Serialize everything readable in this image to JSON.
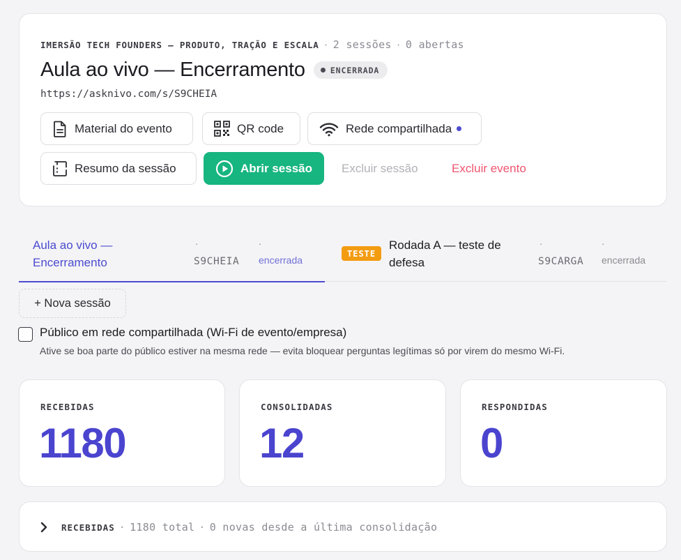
{
  "event": {
    "name": "IMERSÃO TECH FOUNDERS — PRODUTO, TRAÇÃO E ESCALA",
    "sessions_count": "2 sessões",
    "open_count": "0 abertas",
    "separator": "·",
    "session_title": "Aula ao vivo — Encerramento",
    "status": "ENCERRADA",
    "url": "https://asknivo.com/s/S9CHEIA"
  },
  "actions": {
    "material": "Material do evento",
    "qr_code": "QR code",
    "shared_network": "Rede compartilhada",
    "summary": "Resumo da sessão",
    "open_session": "Abrir sessão",
    "delete_session": "Excluir sessão",
    "delete_event": "Excluir evento"
  },
  "tabs": [
    {
      "title_line1": "Aula ao vivo —",
      "title_line2": "Encerramento",
      "bullet": "·",
      "code": "S9CHEIA",
      "state": "encerrada",
      "active": true
    },
    {
      "badge": "TESTE",
      "title_line1": "Rodada A — teste de",
      "title_line2": "defesa",
      "bullet": "·",
      "code": "S9CARGA",
      "state": "encerrada",
      "active": false
    }
  ],
  "new_session": "+ Nova sessão",
  "shared": {
    "label": "Público em rede compartilhada (Wi-Fi de evento/empresa)",
    "help": "Ative se boa parte do público estiver na mesma rede — evita bloquear perguntas legítimas só por virem do mesmo Wi-Fi.",
    "checked": false
  },
  "stats": [
    {
      "label": "RECEBIDAS",
      "value": "1180"
    },
    {
      "label": "CONSOLIDADAS",
      "value": "12"
    },
    {
      "label": "RESPONDIDAS",
      "value": "0"
    }
  ],
  "received_panel": {
    "label": "RECEBIDAS",
    "total": "1180 total",
    "new_since": "0 novas desde a última consolidação"
  },
  "colors": {
    "accent": "#4b4bd0",
    "primary_button": "#17b57f",
    "danger": "#ef5570",
    "test_badge": "#f39c12"
  },
  "icons": [
    "document-icon",
    "qr-code-icon",
    "wifi-icon",
    "summary-icon",
    "play-circle-icon",
    "chevron-right-icon"
  ]
}
